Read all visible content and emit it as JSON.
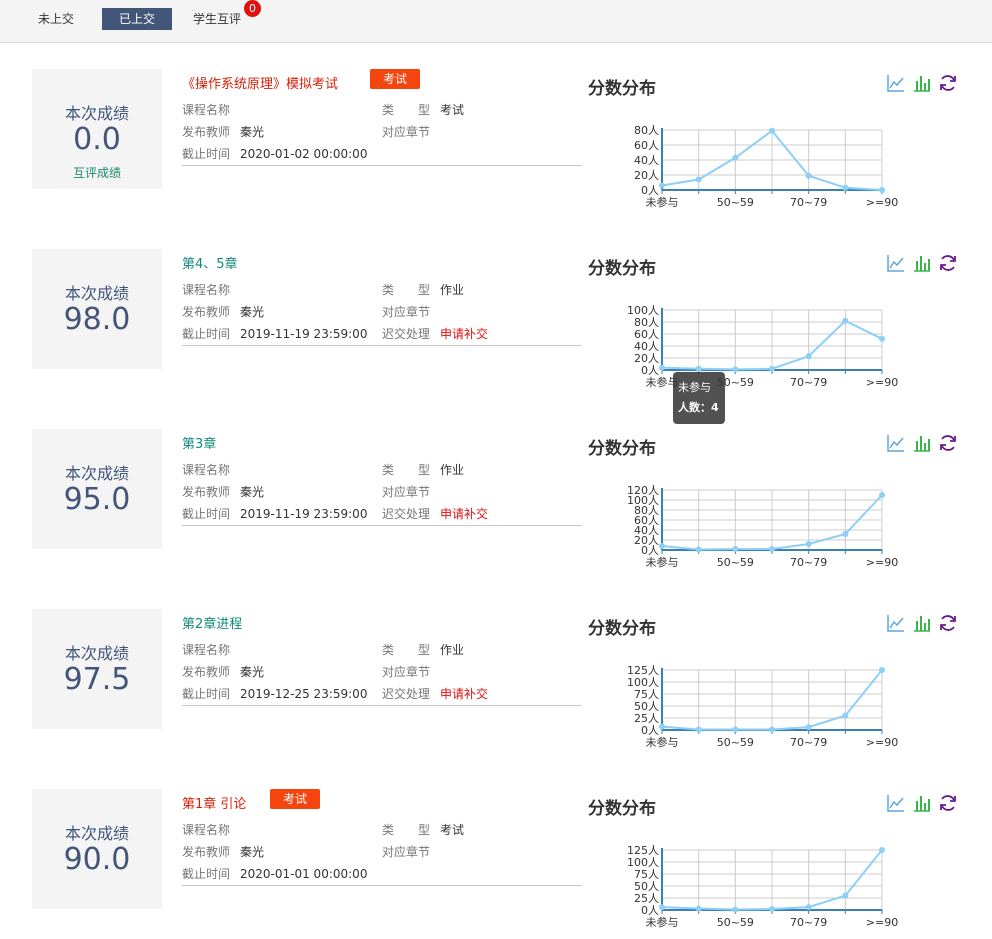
{
  "tabs": [
    {
      "label": "未上交",
      "active": false
    },
    {
      "label": "已上交",
      "active": true
    },
    {
      "label": "学生互评",
      "active": false,
      "badge": "0"
    }
  ],
  "labels": {
    "score_label": "本次成绩",
    "course": "课程名称",
    "teacher": "发布教师",
    "deadline": "截止时间",
    "type": "类　　型",
    "chapter": "对应章节",
    "late": "迟交处理",
    "chart_title": "分数分布",
    "exam_tag": "考试",
    "peer_score": "互评成绩"
  },
  "tooltip": {
    "line1": "未参与",
    "line2": "人数：4"
  },
  "assignments": [
    {
      "title": "《操作系统原理》模拟考试",
      "is_exam": true,
      "score": "0.0",
      "show_peer": true,
      "teacher": "秦光",
      "deadline": "2020-01-02 00:00:00",
      "type": "考试",
      "late_action": ""
    },
    {
      "title": "第4、5章",
      "is_exam": false,
      "score": "98.0",
      "show_peer": false,
      "teacher": "秦光",
      "deadline": "2019-11-19 23:59:00",
      "type": "作业",
      "late_action": "申请补交"
    },
    {
      "title": "第3章",
      "is_exam": false,
      "score": "95.0",
      "show_peer": false,
      "teacher": "秦光",
      "deadline": "2019-11-19 23:59:00",
      "type": "作业",
      "late_action": "申请补交"
    },
    {
      "title": "第2章进程",
      "is_exam": false,
      "score": "97.5",
      "show_peer": false,
      "teacher": "秦光",
      "deadline": "2019-12-25 23:59:00",
      "type": "作业",
      "late_action": "申请补交"
    },
    {
      "title": "第1章 引论",
      "is_exam": true,
      "score": "90.0",
      "show_peer": false,
      "teacher": "秦光",
      "deadline": "2020-01-01 00:00:00",
      "type": "考试",
      "late_action": ""
    }
  ],
  "chart_data": [
    {
      "type": "line",
      "categories": [
        "未参与",
        "",
        "50~59",
        "",
        "70~79",
        "",
        ">=90"
      ],
      "ylim": [
        0,
        80
      ],
      "yticks": [
        "0人",
        "20人",
        "40人",
        "60人",
        "80人"
      ],
      "values": [
        6,
        14,
        43,
        79,
        19,
        3,
        0
      ],
      "color": "#8dcff5"
    },
    {
      "type": "line",
      "categories": [
        "未参与",
        "",
        "50~59",
        "",
        "70~79",
        "",
        ">=90"
      ],
      "ylim": [
        0,
        100
      ],
      "yticks": [
        "0人",
        "20人",
        "40人",
        "60人",
        "80人",
        "100人"
      ],
      "values": [
        4,
        2,
        1,
        2,
        23,
        82,
        52
      ],
      "color": "#8dcff5"
    },
    {
      "type": "line",
      "categories": [
        "未参与",
        "",
        "50~59",
        "",
        "70~79",
        "",
        ">=90"
      ],
      "ylim": [
        0,
        120
      ],
      "yticks": [
        "0人",
        "20人",
        "40人",
        "60人",
        "80人",
        "100人",
        "120人"
      ],
      "values": [
        8,
        1,
        2,
        2,
        12,
        32,
        110
      ],
      "color": "#8dcff5"
    },
    {
      "type": "line",
      "categories": [
        "未参与",
        "",
        "50~59",
        "",
        "70~79",
        "",
        ">=90"
      ],
      "ylim": [
        0,
        125
      ],
      "yticks": [
        "0人",
        "25人",
        "50人",
        "75人",
        "100人",
        "125人"
      ],
      "values": [
        7,
        1,
        1,
        1,
        6,
        30,
        125
      ],
      "color": "#8dcff5"
    },
    {
      "type": "line",
      "categories": [
        "未参与",
        "",
        "50~59",
        "",
        "70~79",
        "",
        ">=90"
      ],
      "ylim": [
        0,
        125
      ],
      "yticks": [
        "0人",
        "25人",
        "50人",
        "75人",
        "100人",
        "125人"
      ],
      "values": [
        6,
        3,
        1,
        2,
        6,
        30,
        125
      ],
      "color": "#8dcff5"
    }
  ]
}
